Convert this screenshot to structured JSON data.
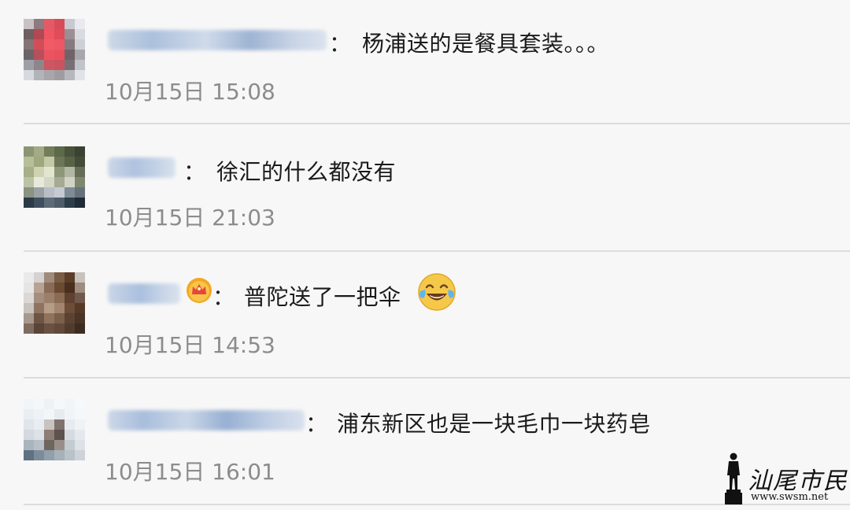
{
  "comments": [
    {
      "text": "杨浦送的是餐具套装。。。",
      "time": "10月15日 15:08",
      "colon": "：",
      "avatar_colors": [
        "#c9c1c3",
        "#8d7b80",
        "#e35a66",
        "#d84c58",
        "#c8c9d1",
        "#e9e9ee",
        "#6e5f63",
        "#b14853",
        "#f05562",
        "#e04c59",
        "#9a8f95",
        "#dadbe0",
        "#847478",
        "#d34d59",
        "#f15b68",
        "#ee5866",
        "#86797f",
        "#cfd0d6",
        "#6d6468",
        "#b8505b",
        "#ec5361",
        "#e8505e",
        "#6f6368",
        "#a7a7ad",
        "#9da0a8",
        "#8e868b",
        "#cf5661",
        "#c9545f",
        "#787074",
        "#c3c4ca",
        "#d7d9df",
        "#b3b4ba",
        "#a9a6ab",
        "#9f9ca1",
        "#b7b8bd",
        "#e2e3e8"
      ]
    },
    {
      "text": "徐汇的什么都没有",
      "time": "10月15日 21:03",
      "colon": "：",
      "avatar_colors": [
        "#8c9571",
        "#a3ab86",
        "#747d59",
        "#5d6948",
        "#49523a",
        "#3b4232",
        "#b6bf99",
        "#9fa77f",
        "#c3c8a5",
        "#6b7558",
        "#586245",
        "#444c39",
        "#a7ae88",
        "#cfd3b2",
        "#e3e6cf",
        "#8f977a",
        "#b2b7a1",
        "#646d55",
        "#bcc2a6",
        "#e7e9dc",
        "#d4d7c6",
        "#a4ab92",
        "#d0d3c6",
        "#7e876d",
        "#8a9280",
        "#9ba2a5",
        "#b8bec5",
        "#c6cad3",
        "#7e8c97",
        "#66727b",
        "#2b3a48",
        "#3f4f5e",
        "#5d6b78",
        "#4e5d69",
        "#2e3d4a",
        "#1f2c37"
      ]
    },
    {
      "text": "普陀送了一把伞",
      "time": "10月15日 14:53",
      "colon": "：",
      "avatar_colors": [
        "#eaeaec",
        "#d5d2d1",
        "#a08a7b",
        "#7a5b44",
        "#5b3d28",
        "#c8c2bd",
        "#e6e5e6",
        "#b7a293",
        "#8a6b55",
        "#6b4a32",
        "#4a2f1c",
        "#9d8c80",
        "#dcd8d5",
        "#a48e7e",
        "#9c7f69",
        "#8a6c55",
        "#5e4130",
        "#70584a",
        "#c9c2bd",
        "#8e7361",
        "#b69b87",
        "#a3846e",
        "#6b4d38",
        "#563a27",
        "#a8998e",
        "#6e5444",
        "#8f735f",
        "#7a5f4b",
        "#5c4231",
        "#4a3426",
        "#7f6c60",
        "#5a4435",
        "#6a5242",
        "#614a3b",
        "#513b2d",
        "#3e2b20"
      ]
    },
    {
      "text": "浦东新区也是一块毛巾一块药皂",
      "time": "10月15日 16:01",
      "colon": "：",
      "avatar_colors": [
        "#f1f5f8",
        "#f4f7fa",
        "#eef2f6",
        "#f5f8fb",
        "#f2f5f8",
        "#f6f9fb",
        "#e9eef3",
        "#eef2f6",
        "#f3f6f9",
        "#e6ebf0",
        "#f1f4f7",
        "#f5f7fa",
        "#dfe5ea",
        "#e9edf1",
        "#c9c3bf",
        "#7f726c",
        "#e7ebef",
        "#f0f3f6",
        "#d3d9df",
        "#dce2e7",
        "#8c7d75",
        "#5e524c",
        "#d6dbe0",
        "#e5e9ed",
        "#aab4bd",
        "#b8c0c7",
        "#6f655f",
        "#9a8f88",
        "#c4cbd1",
        "#dde2e6",
        "#5f7283",
        "#7c8c99",
        "#92a0ab",
        "#a6b1ba",
        "#b9c2c9",
        "#cdd3d8"
      ]
    }
  ],
  "watermark": {
    "title": "汕尾市民网",
    "url": "www.swsm.net"
  }
}
